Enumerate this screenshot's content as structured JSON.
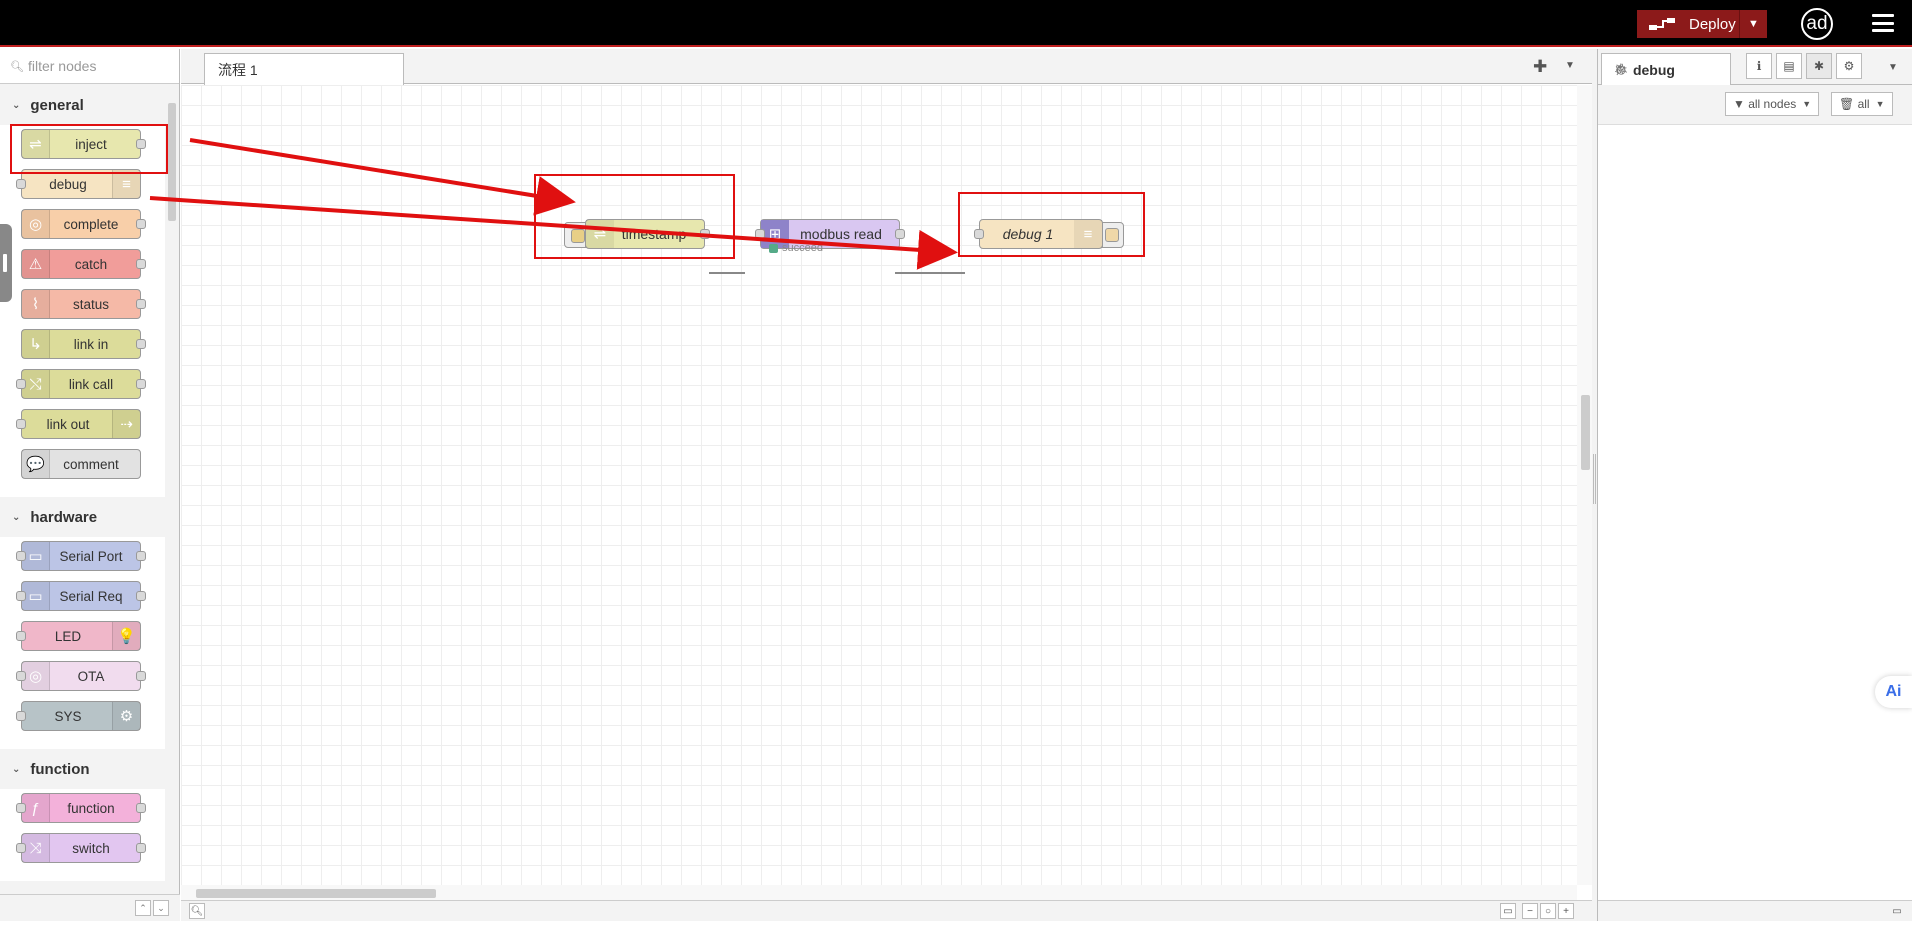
{
  "header": {
    "deploy_label": "Deploy",
    "avatar_text": "ad"
  },
  "palette": {
    "search_placeholder": "filter nodes",
    "categories": [
      {
        "name": "general",
        "nodes": [
          {
            "label": "inject",
            "color": "#e7e7ae",
            "icon": "⇌",
            "in": false,
            "out": true,
            "iconSide": "left"
          },
          {
            "label": "debug",
            "color": "#f6e4c2",
            "icon": "≡",
            "in": true,
            "out": false,
            "iconSide": "right"
          },
          {
            "label": "complete",
            "color": "#f8cfa9",
            "icon": "◎",
            "in": false,
            "out": true,
            "iconSide": "left"
          },
          {
            "label": "catch",
            "color": "#f19d9a",
            "icon": "⚠",
            "in": false,
            "out": true,
            "iconSide": "left"
          },
          {
            "label": "status",
            "color": "#f5b9a7",
            "icon": "⌇",
            "in": false,
            "out": true,
            "iconSide": "left"
          },
          {
            "label": "link in",
            "color": "#dcdc9a",
            "icon": "↳",
            "in": false,
            "out": true,
            "iconSide": "left"
          },
          {
            "label": "link call",
            "color": "#dcdc9a",
            "icon": "⤭",
            "in": true,
            "out": true,
            "iconSide": "left"
          },
          {
            "label": "link out",
            "color": "#dcdc9a",
            "icon": "⇢",
            "in": true,
            "out": false,
            "iconSide": "right"
          },
          {
            "label": "comment",
            "color": "#e2e2e2",
            "icon": "💬",
            "in": false,
            "out": false,
            "iconSide": "left"
          }
        ]
      },
      {
        "name": "hardware",
        "nodes": [
          {
            "label": "Serial Port",
            "color": "#bcc5e6",
            "icon": "▭",
            "in": true,
            "out": true,
            "iconSide": "left"
          },
          {
            "label": "Serial Req",
            "color": "#bcc5e6",
            "icon": "▭",
            "in": true,
            "out": true,
            "iconSide": "left"
          },
          {
            "label": "LED",
            "color": "#f0b7c9",
            "icon": "💡",
            "in": true,
            "out": false,
            "iconSide": "right"
          },
          {
            "label": "OTA",
            "color": "#f1dcee",
            "icon": "◎",
            "in": true,
            "out": true,
            "iconSide": "left"
          },
          {
            "label": "SYS",
            "color": "#b7c3c7",
            "icon": "⚙",
            "in": true,
            "out": false,
            "iconSide": "right"
          }
        ]
      },
      {
        "name": "function",
        "nodes": [
          {
            "label": "function",
            "color": "#f3b1da",
            "icon": "ƒ",
            "in": true,
            "out": true,
            "iconSide": "left"
          },
          {
            "label": "switch",
            "color": "#e2c6f0",
            "icon": "⤨",
            "in": true,
            "out": true,
            "iconSide": "left"
          }
        ]
      }
    ]
  },
  "workspace": {
    "tab_label": "流程 1",
    "nodes": {
      "timestamp": "timestamp",
      "modbus": "modbus read",
      "debug1": "debug 1"
    },
    "status_text": "succeed"
  },
  "sidebar": {
    "tab_label": "debug",
    "filter_label": "all nodes",
    "clear_label": "all"
  },
  "ai_badge": "Ai"
}
